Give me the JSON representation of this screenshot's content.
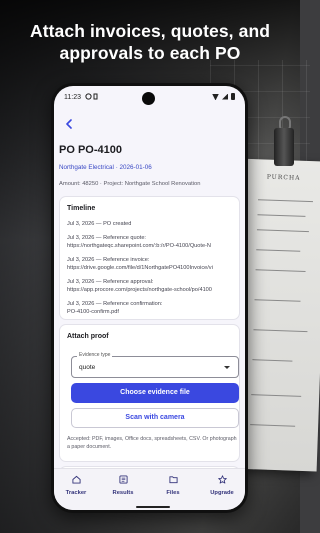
{
  "headline": {
    "line1": "Attach invoices, quotes, and",
    "line2": "approvals to each PO"
  },
  "background_document": {
    "heading": "PURCHA"
  },
  "statusbar": {
    "time": "11:23",
    "icons": [
      "sync-icon",
      "shield-icon",
      "wifi-icon",
      "signal-icon",
      "battery-icon"
    ]
  },
  "po": {
    "title": "PO PO-4100",
    "subtitle": "Northgate Electrical · 2026-01-06",
    "meta": "Amount: 48250 · Project: Northgate School Renovation"
  },
  "timeline": {
    "title": "Timeline",
    "entries": [
      {
        "line1": "Jul 3, 2026 — PO created",
        "line2": ""
      },
      {
        "line1": "Jul 3, 2026 — Reference quote:",
        "line2": "https://northgateqc.sharepoint.com/:b:/r/PO-4100/Quote-N"
      },
      {
        "line1": "Jul 3, 2026 — Reference invoice:",
        "line2": "https://drive.google.com/file/d/1NorthgatePO4100Invoice/vi"
      },
      {
        "line1": "Jul 3, 2026 — Reference approval:",
        "line2": "https://app.procore.com/projects/northgate-school/po/4100"
      },
      {
        "line1": "Jul 3, 2026 — Reference confirmation:",
        "line2": "PO-4100-confirm.pdf"
      }
    ]
  },
  "attach": {
    "title": "Attach proof",
    "evidence_label": "Evidence type",
    "evidence_value": "quote",
    "choose_button": "Choose evidence file",
    "scan_button": "Scan with camera",
    "hint": "Accepted: PDF, images, Office docs, spreadsheets, CSV. Or photograph a paper document."
  },
  "nav": {
    "items": [
      {
        "label": "Tracker",
        "icon": "home-icon"
      },
      {
        "label": "Results",
        "icon": "list-icon"
      },
      {
        "label": "Files",
        "icon": "folder-icon"
      },
      {
        "label": "Upgrade",
        "icon": "star-icon"
      }
    ]
  },
  "colors": {
    "accent": "#3a48e0",
    "link": "#3948c4",
    "surface": "#f6f5fb",
    "card": "#ffffff"
  }
}
